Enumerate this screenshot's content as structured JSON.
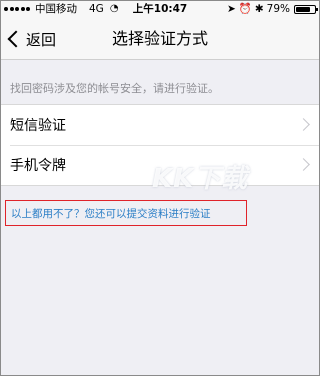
{
  "status_bar": {
    "carrier": "中国移动",
    "network": "4G",
    "time": "上午10:47",
    "battery_percent_label": "79%",
    "battery_level": 0.79
  },
  "nav": {
    "back_label": "返回",
    "title": "选择验证方式"
  },
  "hint": "找回密码涉及您的帐号安全，请进行验证。",
  "options": [
    {
      "label": "短信验证"
    },
    {
      "label": "手机令牌"
    }
  ],
  "alt_link": "以上都用不了？您还可以提交资料进行验证",
  "watermark": "KK下载"
}
